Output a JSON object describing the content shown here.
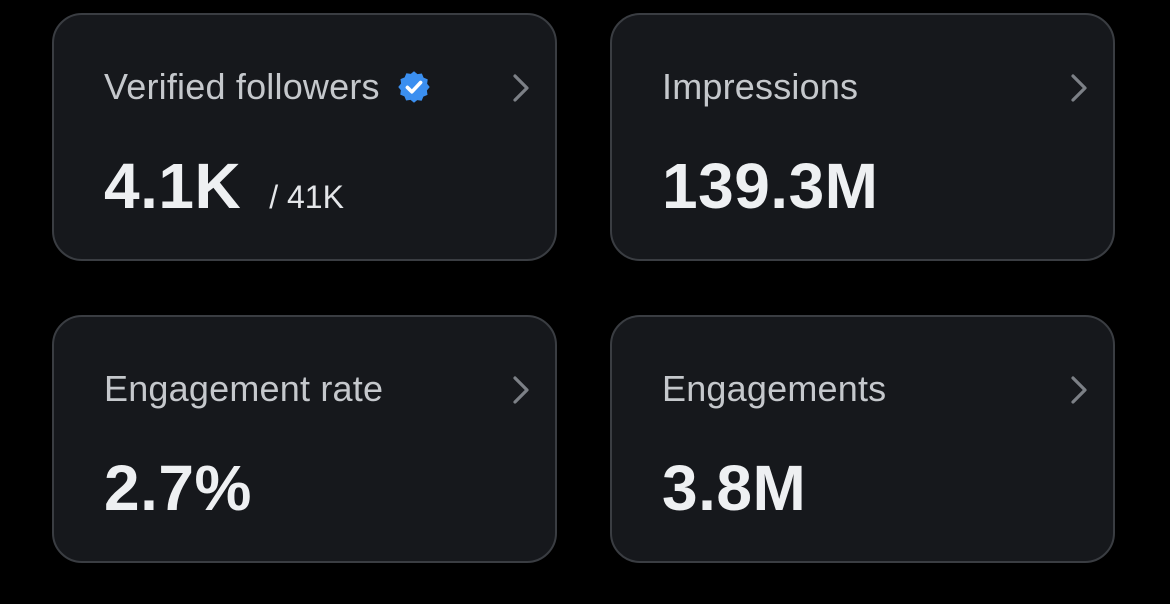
{
  "colors": {
    "background": "#000000",
    "card": "#16181c",
    "card_border": "#3a3d42",
    "label": "#c5c8cc",
    "value": "#eef0f2",
    "verified_badge": "#3b8ff0",
    "chevron": "#7c8086"
  },
  "cards": [
    {
      "label": "Verified followers",
      "value": "4.1K",
      "subvalue": "/ 41K",
      "icon": "verified-badge-icon",
      "chevron_icon": "chevron-right-icon"
    },
    {
      "label": "Impressions",
      "value": "139.3M",
      "chevron_icon": "chevron-right-icon"
    },
    {
      "label": "Engagement rate",
      "value": "2.7%",
      "chevron_icon": "chevron-right-icon"
    },
    {
      "label": "Engagements",
      "value": "3.8M",
      "chevron_icon": "chevron-right-icon"
    }
  ]
}
